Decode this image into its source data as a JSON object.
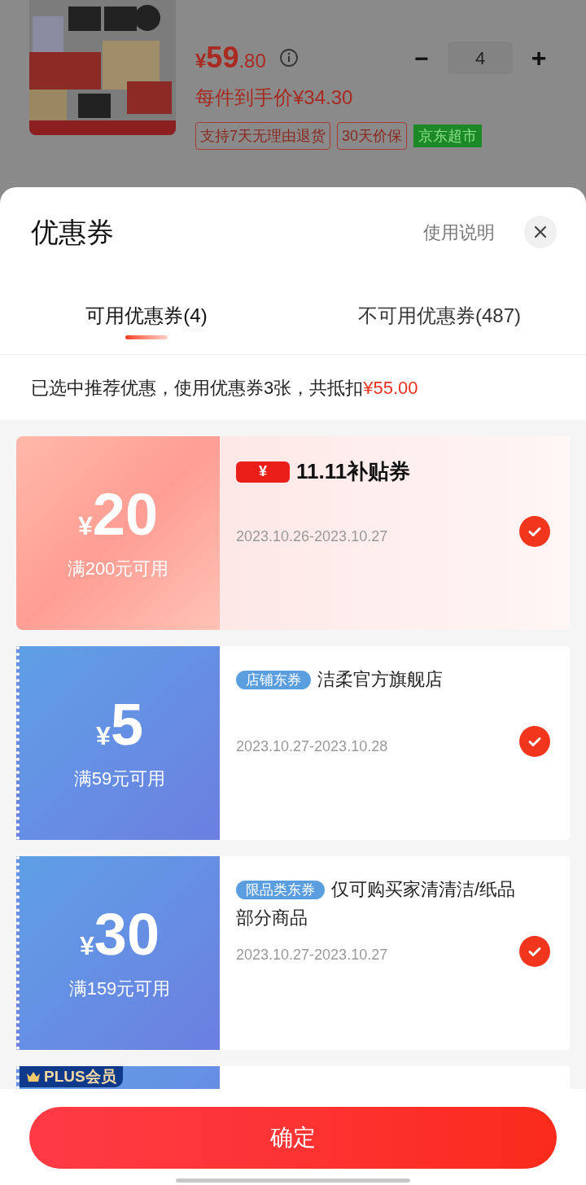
{
  "product": {
    "price_yuan": "¥",
    "price_int": "59",
    "price_dec": ".80",
    "unit_price": "每件到手价¥34.30",
    "quantity": "4",
    "minus": "−",
    "plus": "+",
    "tags": [
      {
        "label": "支持7天无理由退货",
        "kind": "outline"
      },
      {
        "label": "30天价保",
        "kind": "outline"
      },
      {
        "label": "京东超市",
        "kind": "filled"
      }
    ]
  },
  "sheet": {
    "title": "优惠券",
    "help": "使用说明",
    "tabs": [
      {
        "label": "可用优惠券(4)",
        "selected": true
      },
      {
        "label": "不可用优惠券(487)",
        "selected": false
      }
    ],
    "notice": {
      "text": "已选中推荐优惠，使用优惠券3张，共抵扣",
      "amount": "¥55.00"
    },
    "coupons": [
      {
        "kind": "subsidy",
        "currency": "¥",
        "amount": "20",
        "condition": "满200元可用",
        "logo_mark": "¥",
        "logo_text": "11.11补贴券",
        "date": "2023.10.26-2023.10.27",
        "checked": true
      },
      {
        "kind": "store",
        "currency": "¥",
        "amount": "5",
        "condition": "满59元可用",
        "tag": "店铺东券",
        "name": "洁柔官方旗舰店",
        "date": "2023.10.27-2023.10.28",
        "checked": true
      },
      {
        "kind": "store",
        "currency": "¥",
        "amount": "30",
        "condition": "满159元可用",
        "tag": "限品类东券",
        "name": "仅可购买家清清洁/纸品部分商品",
        "date": "2023.10.27-2023.10.27",
        "checked": true
      },
      {
        "kind": "plus",
        "badge": "PLUS会员"
      }
    ],
    "confirm": "确定"
  }
}
